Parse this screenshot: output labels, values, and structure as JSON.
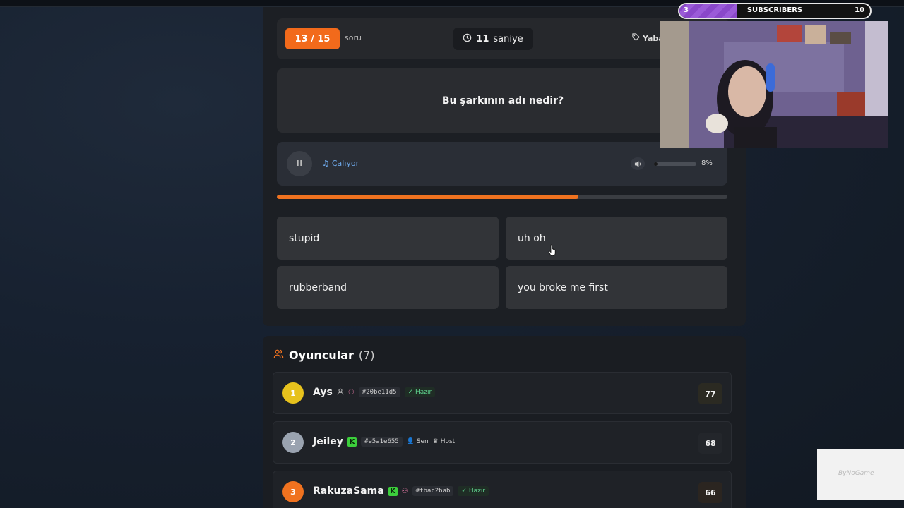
{
  "header": {
    "question_count": "13 / 15",
    "question_unit": "soru",
    "timer_value": "11",
    "timer_unit": "saniye",
    "tag_label": "Yaba"
  },
  "question": {
    "text": "Bu şarkının adı nedir?"
  },
  "player": {
    "status_label": "Çalıyor",
    "volume_percent": "8%",
    "volume_level": 0.08,
    "progress": 0.67
  },
  "answers": [
    {
      "label": "stupid"
    },
    {
      "label": "uh oh"
    },
    {
      "label": "rubberband"
    },
    {
      "label": "you broke me first"
    }
  ],
  "players": {
    "title": "Oyuncular",
    "count": "(7)",
    "rows": [
      {
        "rank": "1",
        "name": "Ays",
        "id": "#20be11d5",
        "status": "Hazır",
        "score": "77",
        "rank_color": "#e7c21d"
      },
      {
        "rank": "2",
        "name": "Jeiley",
        "id": "#e5a1e655",
        "you": "Sen",
        "host": "Host",
        "score": "68",
        "rank_color": "#9aa3b0"
      },
      {
        "rank": "3",
        "name": "RakuzaSama",
        "id": "#fbac2bab",
        "status": "Hazır",
        "score": "66",
        "rank_color": "#f0721f"
      }
    ]
  },
  "overlay": {
    "sub_current": "3",
    "sub_label": "SUBSCRIBERS",
    "sub_goal": "10",
    "sub_progress": 0.3,
    "logo_text": "ByNoGame"
  },
  "colors": {
    "accent": "#f0721f",
    "ready": "#5ed08d",
    "playing": "#6da7e8"
  }
}
